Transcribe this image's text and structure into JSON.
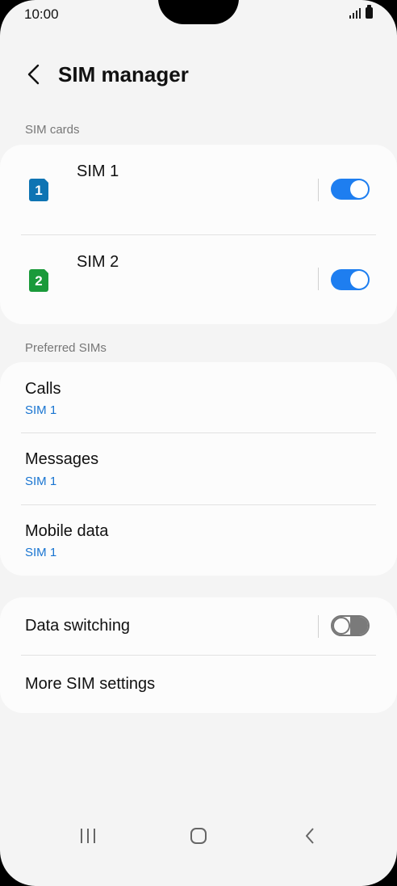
{
  "status_bar": {
    "time": "10:00",
    "signal_icon": "signal-icon",
    "battery_icon": "battery-icon"
  },
  "header": {
    "title": "SIM manager",
    "back_icon": "chevron-left-icon"
  },
  "sim_cards": {
    "label": "SIM cards",
    "items": [
      {
        "name": "SIM 1",
        "badge": "1",
        "color": "#0e74b3",
        "enabled": true
      },
      {
        "name": "SIM 2",
        "badge": "2",
        "color": "#1a9a3a",
        "enabled": true
      }
    ]
  },
  "preferred": {
    "label": "Preferred SIMs",
    "items": [
      {
        "title": "Calls",
        "value": "SIM 1"
      },
      {
        "title": "Messages",
        "value": "SIM 1"
      },
      {
        "title": "Mobile data",
        "value": "SIM 1"
      }
    ]
  },
  "other": {
    "data_switching": {
      "title": "Data switching",
      "enabled": false
    },
    "more": {
      "title": "More SIM settings"
    }
  },
  "colors": {
    "accent": "#1e7ef0",
    "link": "#1874d1"
  },
  "nav_bar": {
    "recents_icon": "recents-icon",
    "home_icon": "home-icon",
    "back_icon": "back-icon"
  }
}
